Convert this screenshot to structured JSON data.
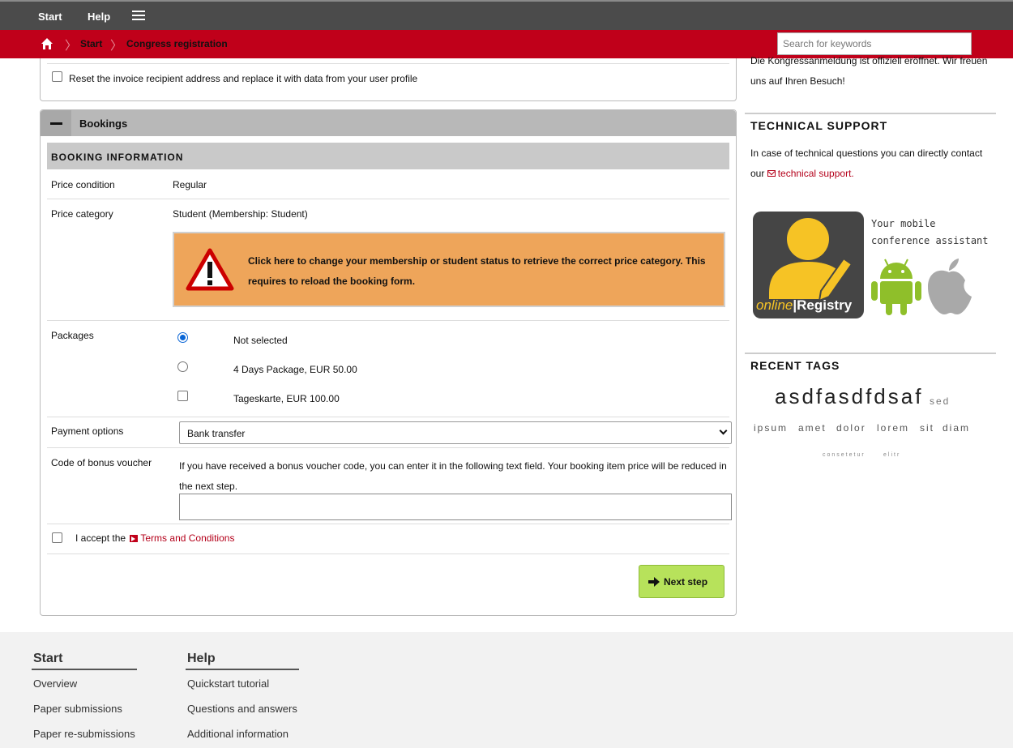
{
  "topnav": {
    "start": "Start",
    "help": "Help"
  },
  "breadcrumb": {
    "start": "Start",
    "current": "Congress registration"
  },
  "search": {
    "placeholder": "Search for keywords"
  },
  "invoice": {
    "reset_label": "Reset the invoice recipient address and replace it with data from your user profile"
  },
  "bookings": {
    "title": "Bookings",
    "section_title": "BOOKING INFORMATION",
    "price_condition": {
      "label": "Price condition",
      "value": "Regular"
    },
    "price_category": {
      "label": "Price category",
      "value": "Student (Membership: Student)",
      "warning": "Click here to change your membership or student status to retrieve the correct price category. This requires to reload the booking form."
    },
    "packages": {
      "label": "Packages",
      "options": [
        "Not selected",
        "4 Days Package, EUR 50.00",
        "Tageskarte, EUR 100.00"
      ],
      "selected": "Not selected"
    },
    "payment": {
      "label": "Payment options",
      "selected": "Bank transfer"
    },
    "voucher": {
      "label": "Code of bonus voucher",
      "help": "If you have received a bonus voucher code, you can enter it in the following text field. Your booking item price will be reduced in the next step.",
      "value": ""
    },
    "terms": {
      "prefix": "I accept the",
      "link": "Terms and Conditions"
    },
    "next_label": "Next step"
  },
  "sidebar": {
    "news_text": "Die Kongressanmeldung ist offiziell eröffnet. Wir freuen uns auf Ihren Besuch!",
    "support_title": "TECHNICAL SUPPORT",
    "support_text": "In case of technical questions you can directly contact our",
    "support_link": "technical support.",
    "app_word_italic": "online",
    "app_word_bold": "Registry",
    "app_tagline": "Your mobile conference assistant",
    "tags_title": "RECENT TAGS",
    "tags": {
      "t1": "asdfasdfdsaf",
      "t2": "sed",
      "t3": "ipsum",
      "t4": "amet",
      "t5": "dolor",
      "t6": "lorem",
      "t7": "sit",
      "t8": "diam",
      "t9": "consetetur",
      "t10": "elitr"
    }
  },
  "footer": {
    "col1": {
      "title": "Start",
      "links": [
        "Overview",
        "Paper submissions",
        "Paper re-submissions"
      ]
    },
    "col2": {
      "title": "Help",
      "links": [
        "Quickstart tutorial",
        "Questions and answers",
        "Additional information"
      ]
    }
  },
  "colors": {
    "brand_red": "#c0001a",
    "topbar": "#4b4b4b",
    "next_button": "#b7e25b",
    "warning": "#eea55a"
  }
}
